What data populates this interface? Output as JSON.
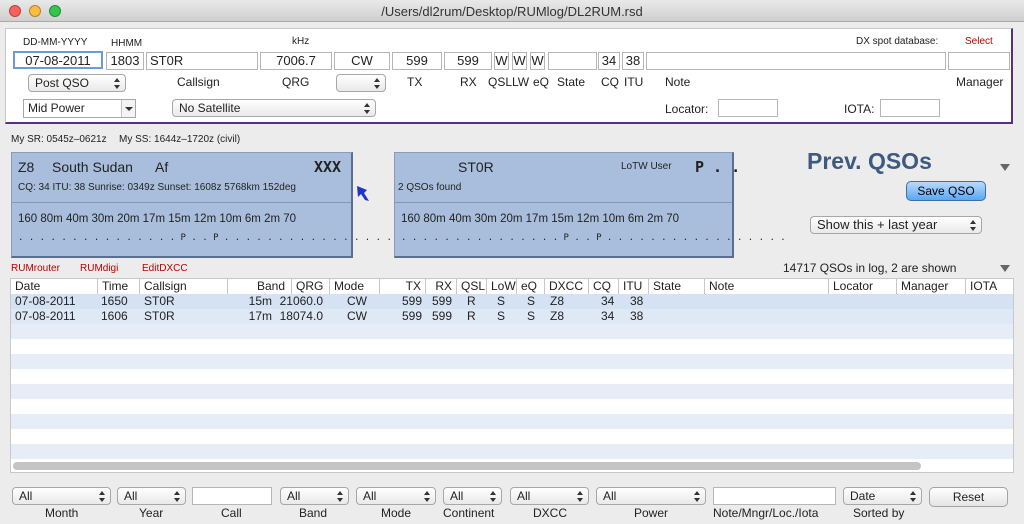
{
  "window": {
    "title": "/Users/dl2rum/Desktop/RUMlog/DL2RUM.rsd"
  },
  "entry": {
    "date_label": "DD-MM-YYYY",
    "date": "07-08-2011",
    "time_label": "HHMM",
    "time": "1803",
    "call": "ST0R",
    "freq_label": "kHz",
    "freq": "7006.7",
    "mode": "CW",
    "tx": "599",
    "rx": "599",
    "qsl": "W",
    "lw": "W",
    "eq": "W",
    "state": "",
    "cq": "34",
    "itu": "38",
    "note": "",
    "manager": "",
    "dx_spot_label": "DX spot database:",
    "select_link": "Select",
    "post_qso": "Post QSO",
    "callsign_label": "Callsign",
    "qrg_label": "QRG",
    "mode_select": "",
    "tx_label": "TX",
    "rx_label": "RX",
    "qsl_label": "QSL",
    "lw_label": "LW",
    "eq_label": "eQ",
    "state_label": "State",
    "cq_label": "CQ",
    "itu_label": "ITU",
    "note_label": "Note",
    "manager_label": "Manager",
    "power": "Mid Power",
    "satellite": "No Satellite",
    "locator_label": "Locator:",
    "locator": "",
    "iota_label": "IOTA:",
    "iota": ""
  },
  "sun": {
    "sr": "My SR: 0545z–0621z",
    "ss": "My SS: 1644z–1720z (civil)"
  },
  "dxcc_box": {
    "prefix": "Z8",
    "country": "South Sudan",
    "continent": "Af",
    "status": "XXX",
    "info": "CQ: 34   ITU: 38   Sunrise: 0349z   Sunset: 1608z   5768km  152deg",
    "bands": "160  80m  40m  30m  20m  17m  15m  12m  10m    6m    2m   70",
    "marks": " . . .   . . .   . . .   . . .   . . .   P . .   P . .   . . .   . . .   . . .   . . .   . . ."
  },
  "call_box": {
    "call": "ST0R",
    "lotw": "LoTW User",
    "status": "P . .",
    "found": "2 QSOs found",
    "bands": "160  80m  40m  30m  20m  17m  15m  12m  10m    6m    2m   70",
    "marks": " . . .   . . .   . . .   . . .   . . .   P . .   P . .   . . .   . . .   . . .   . . .   . . ."
  },
  "prev": {
    "title": "Prev. QSOs",
    "save": "Save QSO",
    "filter": "Show this + last year"
  },
  "links": {
    "rumrouter": "RUMrouter",
    "rumdigi": "RUMdigi",
    "editdxcc": "EditDXCC"
  },
  "log_count": "14717 QSOs in log, 2 are shown",
  "table": {
    "columns": [
      "Date",
      "Time",
      "Callsign",
      "Band",
      "QRG",
      "Mode",
      "TX",
      "RX",
      "QSL",
      "LoW",
      "eQ",
      "DXCC",
      "CQ",
      "ITU",
      "State",
      "Note",
      "Locator",
      "Manager",
      "IOTA"
    ],
    "rows": [
      {
        "date": "07-08-2011",
        "time": "1650",
        "call": "ST0R",
        "band": "15m",
        "qrg": "21060.0",
        "mode": "CW",
        "tx": "599",
        "rx": "599",
        "qsl": "R",
        "low": "S",
        "eq": "S",
        "dxcc": "Z8",
        "cq": "34",
        "itu": "38"
      },
      {
        "date": "07-08-2011",
        "time": "1606",
        "call": "ST0R",
        "band": "17m",
        "qrg": "18074.0",
        "mode": "CW",
        "tx": "599",
        "rx": "599",
        "qsl": "R",
        "low": "S",
        "eq": "S",
        "dxcc": "Z8",
        "cq": "34",
        "itu": "38"
      }
    ]
  },
  "filters": {
    "month": "All",
    "month_label": "Month",
    "year": "All",
    "year_label": "Year",
    "call": "",
    "call_label": "Call",
    "band": "All",
    "band_label": "Band",
    "mode": "All",
    "mode_label": "Mode",
    "continent": "All",
    "continent_label": "Continent",
    "dxcc": "All",
    "dxcc_label": "DXCC",
    "power": "All",
    "power_label": "Power",
    "note": "",
    "note_label": "Note/Mngr/Loc./Iota",
    "sort": "Date",
    "sort_label": "Sorted by",
    "reset": "Reset"
  },
  "colors": {
    "accent": "#58307f",
    "box": "#a9bedc",
    "title": "#3d5a80",
    "link": "#c00000"
  }
}
